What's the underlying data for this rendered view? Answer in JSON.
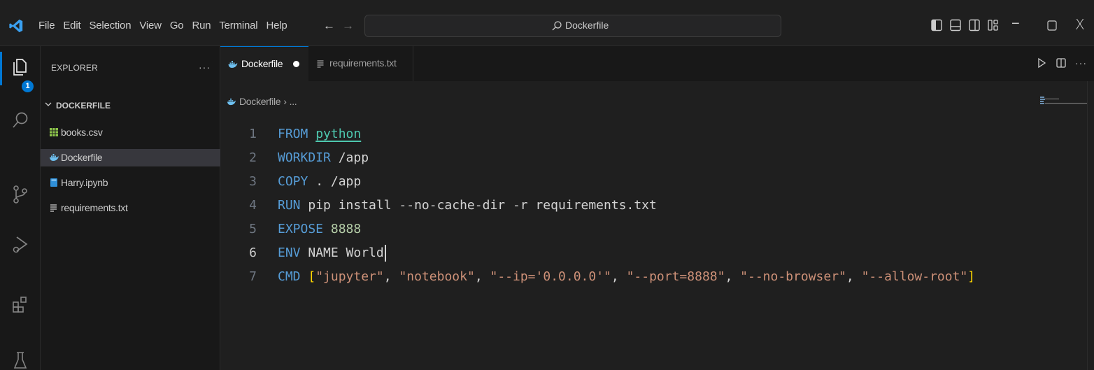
{
  "window": {
    "menu": [
      "File",
      "Edit",
      "Selection",
      "View",
      "Go",
      "Run",
      "Terminal",
      "Help"
    ],
    "nav_back_icon": "arrow-left-icon",
    "nav_forward_icon": "arrow-right-icon",
    "search_text": "Dockerfile",
    "minimize_glyph": "−",
    "close_glyph": "X"
  },
  "activity_bar": {
    "explorer_badge": "1",
    "icons": [
      "explorer-icon",
      "search-icon",
      "source-control-icon",
      "run-debug-icon",
      "extensions-icon",
      "testing-icon"
    ]
  },
  "sidebar": {
    "title": "EXPLORER",
    "more": "···",
    "folder": "DOCKERFILE",
    "files": [
      {
        "label": "books.csv",
        "icon": "csv-file-icon"
      },
      {
        "label": "Dockerfile",
        "icon": "docker-file-icon"
      },
      {
        "label": "Harry.ipynb",
        "icon": "notebook-file-icon"
      },
      {
        "label": "requirements.txt",
        "icon": "text-file-icon"
      }
    ]
  },
  "editor": {
    "tabs": [
      {
        "label": "Dockerfile",
        "dirty": true
      },
      {
        "label": "requirements.txt",
        "dirty": false
      }
    ],
    "breadcrumb": {
      "file": "Dockerfile",
      "sep": "›",
      "rest": "..."
    },
    "more_actions": "···",
    "active_line": 6,
    "lines": [
      {
        "num": "1",
        "tokens": [
          [
            "kw",
            "FROM"
          ],
          [
            "txt",
            " "
          ],
          [
            "img",
            "python"
          ]
        ]
      },
      {
        "num": "2",
        "tokens": [
          [
            "kw",
            "WORKDIR"
          ],
          [
            "txt",
            " /app"
          ]
        ]
      },
      {
        "num": "3",
        "tokens": [
          [
            "kw",
            "COPY"
          ],
          [
            "txt",
            " . /app"
          ]
        ]
      },
      {
        "num": "4",
        "tokens": [
          [
            "kw",
            "RUN"
          ],
          [
            "txt",
            " pip install --no-cache-dir -r requirements.txt"
          ]
        ]
      },
      {
        "num": "5",
        "tokens": [
          [
            "kw",
            "EXPOSE"
          ],
          [
            "txt",
            " "
          ],
          [
            "num",
            "8888"
          ]
        ]
      },
      {
        "num": "6",
        "tokens": [
          [
            "kw",
            "ENV"
          ],
          [
            "txt",
            " NAME World"
          ]
        ]
      },
      {
        "num": "7",
        "tokens": [
          [
            "kw",
            "CMD"
          ],
          [
            "txt",
            " "
          ],
          [
            "br",
            "["
          ],
          [
            "str",
            "\"jupyter\""
          ],
          [
            "txt",
            ", "
          ],
          [
            "str",
            "\"notebook\""
          ],
          [
            "txt",
            ", "
          ],
          [
            "str",
            "\"--ip='0.0.0.0'\""
          ],
          [
            "txt",
            ", "
          ],
          [
            "str",
            "\"--port=8888\""
          ],
          [
            "txt",
            ", "
          ],
          [
            "str",
            "\"--no-browser\""
          ],
          [
            "txt",
            ", "
          ],
          [
            "str",
            "\"--allow-root\""
          ],
          [
            "br",
            "]"
          ]
        ]
      }
    ]
  },
  "colors": {
    "accent": "#0078d4",
    "keyword": "#569cd6",
    "string": "#ce9178",
    "number": "#b5cea8",
    "image": "#4ec9b0",
    "bracket": "#ffd700"
  }
}
